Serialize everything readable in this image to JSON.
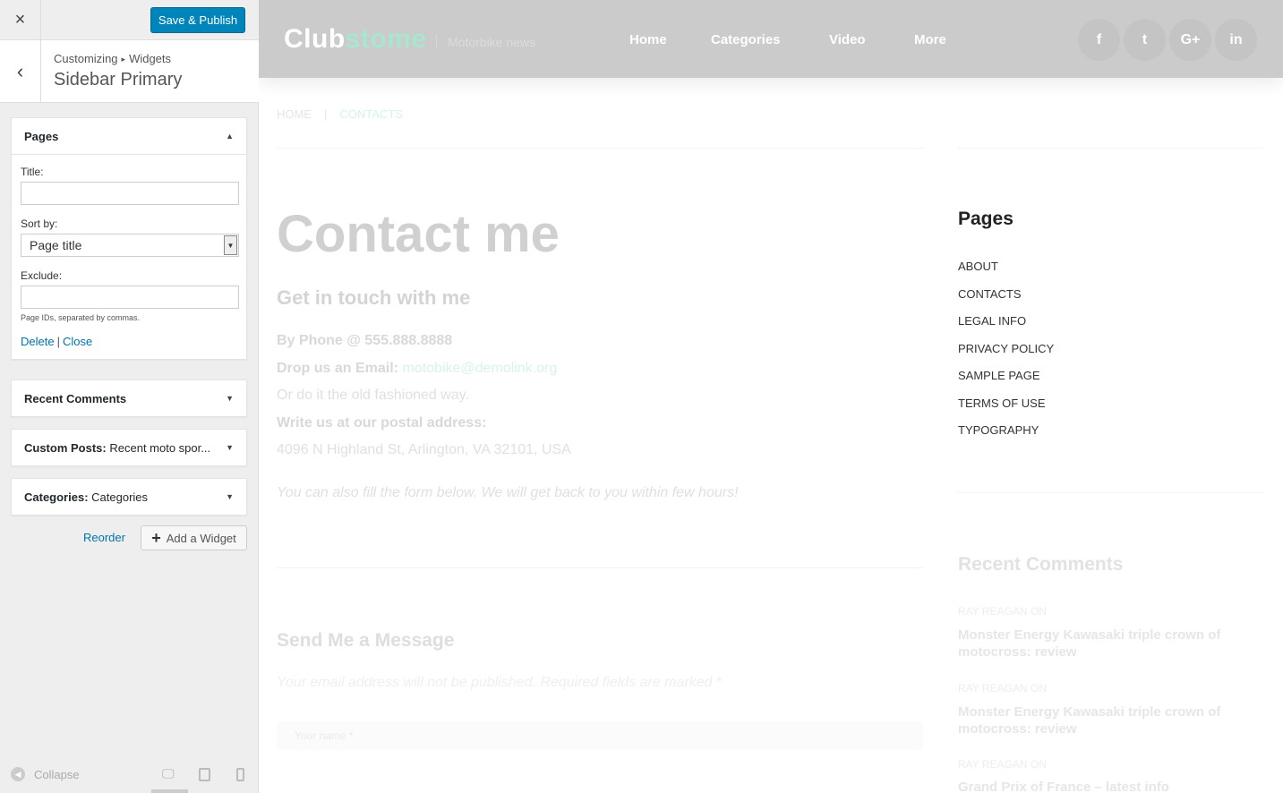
{
  "customizer": {
    "close_icon": "×",
    "save_label": "Save & Publish",
    "back_icon": "‹",
    "breadcrumb": {
      "root": "Customizing",
      "separator": "▸",
      "current": "Widgets"
    },
    "section_title": "Sidebar Primary",
    "widgets": [
      {
        "title": "Pages",
        "subtitle": "",
        "expanded": true
      },
      {
        "title": "Recent Comments",
        "subtitle": "",
        "expanded": false
      },
      {
        "title": "Custom Posts:",
        "subtitle": "Recent moto spor...",
        "expanded": false
      },
      {
        "title": "Categories:",
        "subtitle": "Categories",
        "expanded": false
      }
    ],
    "pages_form": {
      "title_label": "Title:",
      "title_value": "",
      "sort_label": "Sort by:",
      "sort_value": "Page title",
      "exclude_label": "Exclude:",
      "exclude_value": "",
      "exclude_hint": "Page IDs, separated by commas.",
      "delete_label": "Delete",
      "divider": "|",
      "close_label": "Close"
    },
    "reorder_label": "Reorder",
    "add_widget_label": "Add a Widget",
    "collapse_label": "Collapse",
    "devices": [
      "desktop-icon",
      "tablet-icon",
      "mobile-icon"
    ]
  },
  "preview": {
    "logo": {
      "part1": "Club",
      "part2": "stome"
    },
    "tagline": "Motorbike news",
    "nav": [
      "Home",
      "Categories",
      "Video",
      "More"
    ],
    "social": [
      "f",
      "t",
      "G+",
      "in"
    ],
    "breadcrumb": {
      "home": "HOME",
      "pipe": "|",
      "current": "CONTACTS"
    },
    "heading": "Contact me",
    "subheading": "Get in touch with me",
    "phone": "By Phone @ 555.888.8888",
    "email_label": "Drop us an Email:",
    "email": "motobike@demolink.org",
    "old_fashioned": "Or do it the old fashioned way.",
    "postal_label": "Write us at our postal address:",
    "address": "4096 N Highland St, Arlington, VA 32101, USA",
    "form_note": "You can also fill the form below. We will get back to you within few hours!",
    "send_title": "Send Me a Message",
    "required_note": "Your email address will not be published. Required fields are marked *",
    "name_placeholder": "Your name *",
    "sidebar_pages_title": "Pages",
    "pages": [
      "ABOUT",
      "CONTACTS",
      "LEGAL INFO",
      "PRIVACY POLICY",
      "SAMPLE PAGE",
      "TERMS OF USE",
      "TYPOGRAPHY"
    ],
    "recent_comments_title": "Recent Comments",
    "comments": [
      {
        "author": "RAY REAGAN ON",
        "post": "Monster Energy Kawasaki triple crown of motocross: review"
      },
      {
        "author": "RAY REAGAN ON",
        "post": "Monster Energy Kawasaki triple crown of motocross: review"
      },
      {
        "author": "RAY REAGAN ON",
        "post": "Grand Prix of France – latest info"
      }
    ]
  }
}
